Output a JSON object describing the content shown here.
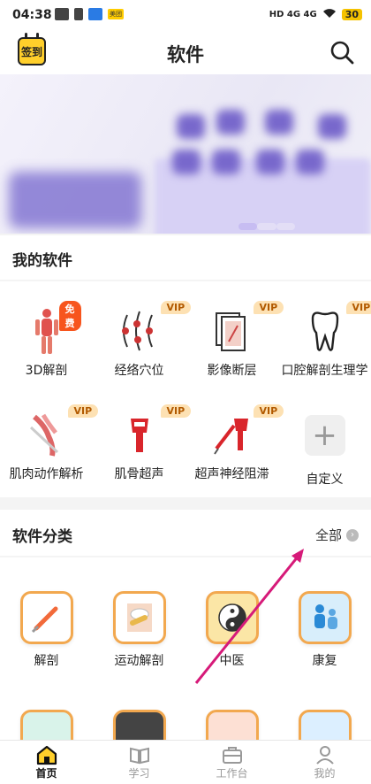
{
  "status": {
    "time": "04:38",
    "right_text": "HD 4G 4G",
    "battery": "30",
    "app_badge": "美团"
  },
  "header": {
    "title": "软件",
    "checkin_label": "签到"
  },
  "my_software": {
    "title": "我的软件",
    "items": [
      {
        "label": "3D解剖",
        "badge": "免费",
        "icon": "human-body-icon"
      },
      {
        "label": "经络穴位",
        "badge": "VIP",
        "icon": "meridian-icon"
      },
      {
        "label": "影像断层",
        "badge": "VIP",
        "icon": "scan-films-icon"
      },
      {
        "label": "口腔解剖生理学",
        "badge": "VIP",
        "icon": "tooth-icon"
      },
      {
        "label": "肌肉动作解析",
        "badge": "VIP",
        "icon": "muscle-icon"
      },
      {
        "label": "肌骨超声",
        "badge": "VIP",
        "icon": "ultrasound-probe-icon"
      },
      {
        "label": "超声神经阻滞",
        "badge": "VIP",
        "icon": "needle-probe-icon"
      },
      {
        "label": "自定义",
        "badge": "",
        "icon": "plus-icon"
      }
    ]
  },
  "categories": {
    "title": "软件分类",
    "all_label": "全部",
    "items": [
      {
        "label": "解剖",
        "icon": "scalpel-icon"
      },
      {
        "label": "运动解剖",
        "icon": "joint-icon"
      },
      {
        "label": "中医",
        "icon": "yin-yang-icon"
      },
      {
        "label": "康复",
        "icon": "rehab-icon"
      }
    ],
    "partial_row": [
      "tooth-icon",
      "xray-icon",
      "clipboard-icon",
      "example-icon"
    ]
  },
  "tabs": [
    {
      "label": "首页",
      "icon": "home-icon",
      "active": true
    },
    {
      "label": "学习",
      "icon": "book-icon",
      "active": false
    },
    {
      "label": "工作台",
      "icon": "briefcase-icon",
      "active": false
    },
    {
      "label": "我的",
      "icon": "person-icon",
      "active": false
    }
  ],
  "colors": {
    "accent": "#ffcf2b",
    "vip_bg": "#fde1b3",
    "free_bg": "#f7551d",
    "tile_border": "#f2a84f"
  }
}
